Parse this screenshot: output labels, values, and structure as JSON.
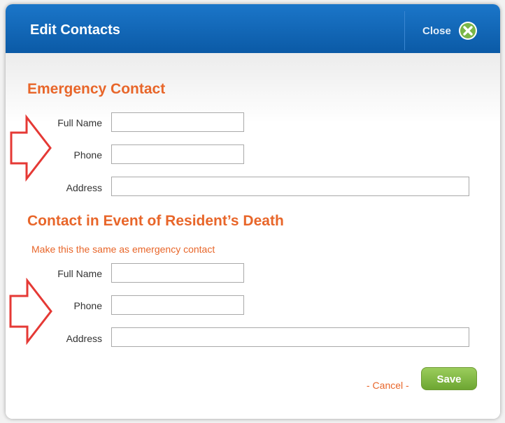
{
  "modal": {
    "title": "Edit Contacts",
    "close_label": "Close"
  },
  "emergency": {
    "title": "Emergency Contact",
    "full_name_label": "Full Name",
    "full_name_value": "",
    "phone_label": "Phone",
    "phone_value": "",
    "address_label": "Address",
    "address_value": ""
  },
  "death": {
    "title": "Contact in Event of Resident’s Death",
    "same_as_link": "Make this the same as emergency contact",
    "full_name_label": "Full Name",
    "full_name_value": "",
    "phone_label": "Phone",
    "phone_value": "",
    "address_label": "Address",
    "address_value": ""
  },
  "footer": {
    "cancel_label": "- Cancel -",
    "save_label": "Save"
  },
  "colors": {
    "header": "#1b76c9",
    "accent": "#e8662a",
    "save": "#7cb342",
    "annotation_arrow": "#e53935"
  },
  "icons": {
    "close": "close-x-circle-icon",
    "arrows": "red-outline-arrow-icon"
  }
}
